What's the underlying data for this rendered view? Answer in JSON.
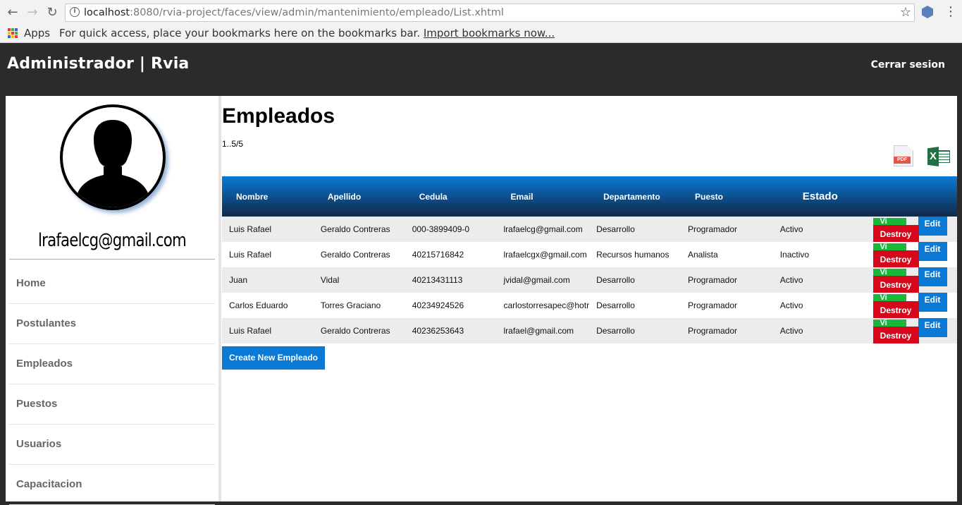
{
  "browser": {
    "url_host": "localhost",
    "url_rest": ":8080/rvia-project/faces/view/admin/mantenimiento/empleado/List.xhtml",
    "apps_label": "Apps",
    "bookmarks_message": "For quick access, place your bookmarks here on the bookmarks bar.",
    "bookmarks_link": "Import bookmarks now..."
  },
  "header": {
    "brand": "Administrador | Rvia",
    "logout": "Cerrar sesion"
  },
  "sidebar": {
    "user_email": "lrafaelcg@gmail.com",
    "items": [
      {
        "label": "Home"
      },
      {
        "label": "Postulantes"
      },
      {
        "label": "Empleados"
      },
      {
        "label": "Puestos"
      },
      {
        "label": "Usuarios"
      },
      {
        "label": "Capacitacion"
      }
    ]
  },
  "main": {
    "title": "Empleados",
    "pager": "1..5/5",
    "pdf_label": "PDF",
    "excel_label": "X",
    "columns": [
      "Nombre",
      "Apellido",
      "Cedula",
      "Email",
      "Departamento",
      "Puesto",
      "Estado"
    ],
    "rows": [
      {
        "nombre": "Luis Rafael",
        "apellido": "Geraldo Contreras",
        "cedula": "000-3899409-0",
        "email": "lrafaelcg@gmail.com",
        "departamento": "Desarrollo",
        "puesto": "Programador",
        "estado": "Activo"
      },
      {
        "nombre": "Luis Rafael",
        "apellido": "Geraldo Contreras",
        "cedula": "40215716842",
        "email": "lrafaelcgx@gmail.com",
        "departamento": "Recursos humanos",
        "puesto": "Analista",
        "estado": "Inactivo"
      },
      {
        "nombre": "Juan",
        "apellido": "Vidal",
        "cedula": "40213431113",
        "email": "jvidal@gmail.com",
        "departamento": "Desarrollo",
        "puesto": "Programador",
        "estado": "Activo"
      },
      {
        "nombre": "Carlos Eduardo",
        "apellido": "Torres Graciano",
        "cedula": "40234924526",
        "email": "carlostorresapec@hotr",
        "departamento": "Desarrollo",
        "puesto": "Programador",
        "estado": "Activo"
      },
      {
        "nombre": "Luis Rafael",
        "apellido": "Geraldo Contreras",
        "cedula": "40236253643",
        "email": "lrafael@gmail.com",
        "departamento": "Desarrollo",
        "puesto": "Programador",
        "estado": "Activo"
      }
    ],
    "actions": {
      "view": "Vi",
      "destroy": "Destroy",
      "edit": "Edit"
    },
    "create_button": "Create New Empleado"
  },
  "colors": {
    "header_bg": "#2b2b2b",
    "primary_blue": "#0a7ad6",
    "destroy_red": "#d6061b",
    "view_green": "#18b83a"
  }
}
